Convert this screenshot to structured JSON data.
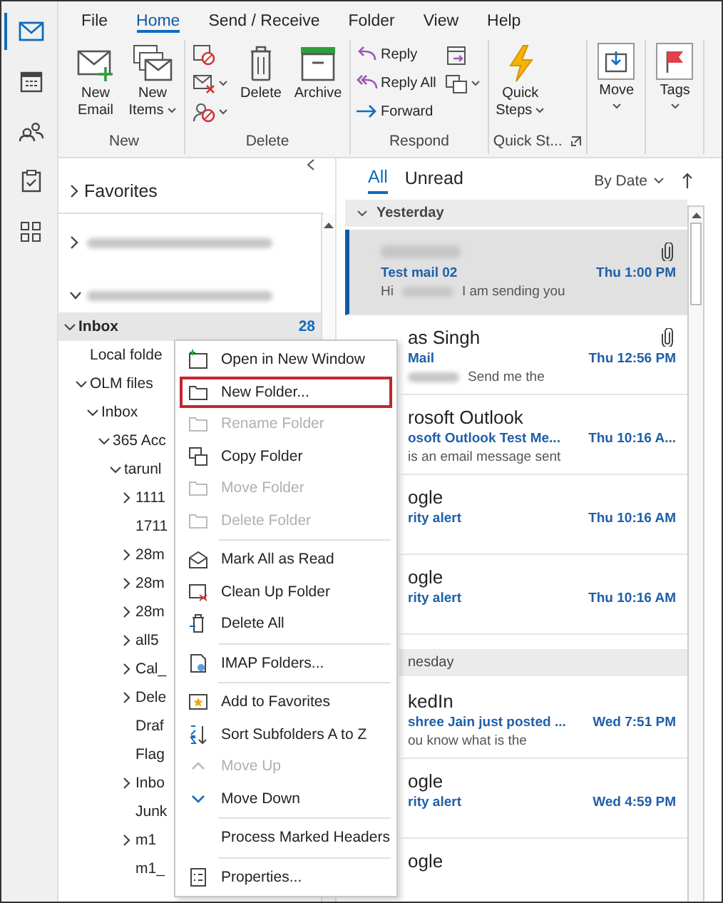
{
  "nav": [
    {
      "selected": true
    },
    {
      "selected": false
    },
    {
      "selected": false
    },
    {
      "selected": false
    },
    {
      "selected": false
    }
  ],
  "ribbon": {
    "tabs": [
      {
        "label": "File",
        "selected": false
      },
      {
        "label": "Home",
        "selected": true
      },
      {
        "label": "Send / Receive",
        "selected": false
      },
      {
        "label": "Folder",
        "selected": false
      },
      {
        "label": "View",
        "selected": false
      },
      {
        "label": "Help",
        "selected": false
      }
    ],
    "groups": [
      {
        "label": "New",
        "launcher": false,
        "buttons": [
          {
            "kind": "large",
            "label": "New Email",
            "dropdown": false
          },
          {
            "kind": "large",
            "label": "New Items",
            "dropdown": true
          }
        ]
      },
      {
        "label": "Delete",
        "launcher": false,
        "buttons": [
          {
            "kind": "icon",
            "dropdown": false
          },
          {
            "kind": "icon",
            "dropdown": true
          },
          {
            "kind": "icon",
            "dropdown": true
          },
          {
            "kind": "large",
            "label": "Delete",
            "dropdown": false
          },
          {
            "kind": "large",
            "label": "Archive",
            "dropdown": false
          }
        ]
      },
      {
        "label": "Respond",
        "launcher": false,
        "buttons": [
          {
            "kind": "small",
            "label": "Reply",
            "dropdown": false
          },
          {
            "kind": "small",
            "label": "Reply All",
            "dropdown": false
          },
          {
            "kind": "small",
            "label": "Forward",
            "dropdown": false
          },
          {
            "kind": "icon",
            "dropdown": false
          },
          {
            "kind": "icon",
            "dropdown": true
          }
        ]
      },
      {
        "label": "Quick St...",
        "launcher": true,
        "buttons": [
          {
            "kind": "large",
            "label": "Quick Steps",
            "dropdown": true
          }
        ]
      },
      {
        "launcher": false,
        "buttons": [
          {
            "kind": "boxed",
            "label": "Move",
            "dropdown": true
          }
        ]
      },
      {
        "launcher": false,
        "buttons": [
          {
            "kind": "boxed",
            "label": "Tags",
            "dropdown": true
          }
        ]
      }
    ]
  },
  "folder_pane": {
    "favorites": {
      "label": "Favorites",
      "expanded": false
    },
    "accounts": [
      {
        "expanded": false
      },
      {
        "expanded": true
      }
    ],
    "folders": [
      {
        "label": "Inbox",
        "count": "28",
        "selected": true,
        "expanded": true,
        "children": [
          {
            "label": "Local folde",
            "selected": false
          },
          {
            "label": "OLM files",
            "selected": false,
            "expanded": true,
            "children": [
              {
                "label": "Inbox",
                "selected": false,
                "expanded": true,
                "children": [
                  {
                    "label": "365 Acc",
                    "selected": false,
                    "expanded": true,
                    "children": [
                      {
                        "label": "tarunl",
                        "selected": false,
                        "expanded": true,
                        "children": [
                          {
                            "label": "1111",
                            "selected": false,
                            "expanded": false
                          },
                          {
                            "label": "1711",
                            "selected": false
                          },
                          {
                            "label": "28m",
                            "selected": false,
                            "expanded": false
                          },
                          {
                            "label": "28m",
                            "selected": false,
                            "expanded": false
                          },
                          {
                            "label": "28m",
                            "selected": false,
                            "expanded": false
                          },
                          {
                            "label": "all5",
                            "selected": false,
                            "expanded": false
                          },
                          {
                            "label": "Cal_",
                            "selected": false,
                            "expanded": false
                          },
                          {
                            "label": "Dele",
                            "selected": false,
                            "expanded": false
                          },
                          {
                            "label": "Draf",
                            "selected": false
                          },
                          {
                            "label": "Flag",
                            "selected": false
                          },
                          {
                            "label": "Inbo",
                            "selected": false,
                            "expanded": false
                          },
                          {
                            "label": "Junk",
                            "selected": false
                          },
                          {
                            "label": "m1",
                            "selected": false,
                            "expanded": false
                          },
                          {
                            "label": "m1_",
                            "selected": false
                          }
                        ]
                      }
                    ]
                  }
                ]
              }
            ]
          }
        ]
      }
    ]
  },
  "message_list": {
    "tabs": [
      {
        "label": "All",
        "selected": true
      },
      {
        "label": "Unread",
        "selected": false
      }
    ],
    "sort": "By Date",
    "groups": [
      {
        "label": "Yesterday",
        "messages": [
          {
            "sender": [
              {
                "kind": "blur"
              }
            ],
            "subject": "Test mail 02",
            "time": "Thu 1:00 PM",
            "preview": [
              {
                "kind": "text",
                "text": "Hi"
              },
              {
                "kind": "blur"
              },
              {
                "kind": "text",
                "text": "I am sending you"
              }
            ],
            "attachment": true,
            "selected": true
          },
          {
            "sender": [
              {
                "kind": "text",
                "text": "as Singh"
              }
            ],
            "subject": "Mail",
            "time": "Thu 12:56 PM",
            "preview": [
              {
                "kind": "blur"
              },
              {
                "kind": "text",
                "text": "Send me the"
              }
            ],
            "attachment": true,
            "selected": false
          },
          {
            "sender": [
              {
                "kind": "text",
                "text": "rosoft Outlook"
              }
            ],
            "subject": "osoft Outlook Test Me...",
            "time": "Thu 10:16 A...",
            "preview": [
              {
                "kind": "text",
                "text": "is an email message sent"
              }
            ],
            "attachment": false,
            "selected": false
          },
          {
            "sender": [
              {
                "kind": "text",
                "text": "ogle"
              }
            ],
            "subject": "rity alert",
            "time": "Thu 10:16 AM",
            "attachment": false,
            "selected": false
          },
          {
            "sender": [
              {
                "kind": "text",
                "text": "ogle"
              }
            ],
            "subject": "rity alert",
            "time": "Thu 10:16 AM",
            "attachment": false,
            "selected": false
          }
        ]
      },
      {
        "label": "nesday",
        "messages": [
          {
            "sender": [
              {
                "kind": "text",
                "text": "kedIn"
              }
            ],
            "subject": "shree Jain just posted ...",
            "time": "Wed 7:51 PM",
            "preview": [
              {
                "kind": "text",
                "text": "ou know what is the"
              }
            ],
            "attachment": false,
            "selected": false
          },
          {
            "sender": [
              {
                "kind": "text",
                "text": "ogle"
              }
            ],
            "subject": "rity alert",
            "time": "Wed 4:59 PM",
            "attachment": false,
            "selected": false
          },
          {
            "sender": [
              {
                "kind": "text",
                "text": "ogle"
              }
            ],
            "attachment": false,
            "selected": false
          }
        ]
      }
    ]
  },
  "context_menu": {
    "items": [
      {
        "kind": "item",
        "label": "Open in New Window",
        "disabled": false,
        "highlighted": false
      },
      {
        "kind": "item",
        "label": "New Folder...",
        "disabled": false,
        "highlighted": true
      },
      {
        "kind": "item",
        "label": "Rename Folder",
        "disabled": true,
        "highlighted": false
      },
      {
        "kind": "item",
        "label": "Copy Folder",
        "disabled": false,
        "highlighted": false
      },
      {
        "kind": "item",
        "label": "Move Folder",
        "disabled": true,
        "highlighted": false
      },
      {
        "kind": "item",
        "label": "Delete Folder",
        "disabled": true,
        "highlighted": false
      },
      {
        "kind": "separator"
      },
      {
        "kind": "item",
        "label": "Mark All as Read",
        "disabled": false,
        "highlighted": false
      },
      {
        "kind": "item",
        "label": "Clean Up Folder",
        "disabled": false,
        "highlighted": false
      },
      {
        "kind": "item",
        "label": "Delete All",
        "disabled": false,
        "highlighted": false
      },
      {
        "kind": "separator"
      },
      {
        "kind": "item",
        "label": "IMAP Folders...",
        "disabled": false,
        "highlighted": false
      },
      {
        "kind": "separator"
      },
      {
        "kind": "item",
        "label": "Add to Favorites",
        "disabled": false,
        "highlighted": false
      },
      {
        "kind": "item",
        "label": "Sort Subfolders A to Z",
        "disabled": false,
        "highlighted": false
      },
      {
        "kind": "item",
        "label": "Move Up",
        "disabled": true,
        "highlighted": false
      },
      {
        "kind": "item",
        "label": "Move Down",
        "disabled": false,
        "highlighted": false
      },
      {
        "kind": "separator"
      },
      {
        "kind": "item",
        "label": "Process Marked Headers",
        "disabled": false,
        "highlighted": false
      },
      {
        "kind": "separator"
      },
      {
        "kind": "item",
        "label": "Properties...",
        "disabled": false,
        "highlighted": false
      }
    ]
  }
}
